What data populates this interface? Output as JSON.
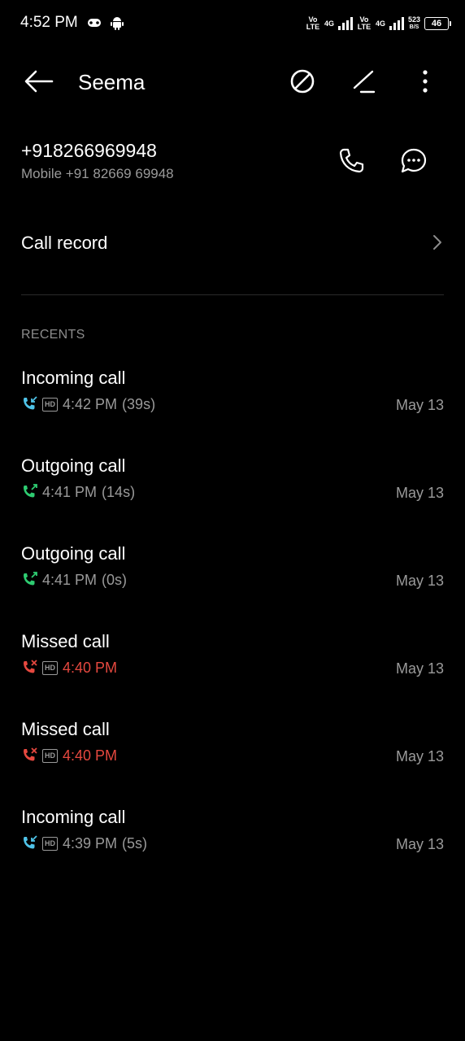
{
  "status_bar": {
    "time": "4:52 PM",
    "sim1_volte": "Vo LTE",
    "sim1_network": "4G",
    "sim2_volte": "Vo LTE",
    "sim2_network": "4G",
    "speed_value": "523",
    "speed_unit": "B/S",
    "battery": "46",
    "icons": [
      "game-controller-icon",
      "android-icon",
      "signal-icon",
      "battery-icon"
    ]
  },
  "app_bar": {
    "title": "Seema",
    "icons": [
      "back-arrow-icon",
      "block-icon",
      "edit-icon",
      "more-vert-icon"
    ]
  },
  "contact": {
    "number": "+918266969948",
    "detail": "Mobile +91 82669 69948",
    "icons": [
      "phone-icon",
      "message-icon"
    ]
  },
  "call_record": {
    "label": "Call record",
    "icon": "chevron-right-icon"
  },
  "recents": {
    "header": "RECENTS",
    "items": [
      {
        "title": "Incoming call",
        "time": "4:42 PM",
        "duration": "(39s)",
        "date": "May 13",
        "kind": "incoming",
        "hd": "HD"
      },
      {
        "title": "Outgoing call",
        "time": "4:41 PM",
        "duration": "(14s)",
        "date": "May 13",
        "kind": "outgoing",
        "hd": ""
      },
      {
        "title": "Outgoing call",
        "time": "4:41 PM",
        "duration": "(0s)",
        "date": "May 13",
        "kind": "outgoing",
        "hd": ""
      },
      {
        "title": "Missed call",
        "time": "4:40 PM",
        "duration": "",
        "date": "May 13",
        "kind": "missed",
        "hd": "HD"
      },
      {
        "title": "Missed call",
        "time": "4:40 PM",
        "duration": "",
        "date": "May 13",
        "kind": "missed",
        "hd": "HD"
      },
      {
        "title": "Incoming call",
        "time": "4:39 PM",
        "duration": "(5s)",
        "date": "May 13",
        "kind": "incoming",
        "hd": "HD"
      }
    ]
  },
  "colors": {
    "background": "#000000",
    "text_primary": "#ffffff",
    "text_secondary": "#9a9a9a",
    "incoming": "#4fc3e8",
    "outgoing": "#2ecc71",
    "missed": "#e5483f"
  }
}
